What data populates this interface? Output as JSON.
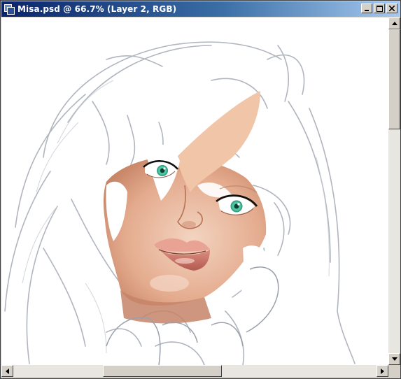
{
  "window": {
    "title": "Misa.psd @ 66.7% (Layer 2, RGB)"
  },
  "title_controls": [
    "minimize-icon",
    "maximize-icon",
    "close-icon"
  ],
  "canvas": {
    "content": "illustration-portrait"
  },
  "scrollbars": {
    "vertical": {
      "position": 0.12
    },
    "horizontal": {
      "position": 0.25
    }
  },
  "colors": {
    "titlebar_start": "#0a246a",
    "titlebar_end": "#a6caf0",
    "chrome": "#d4d0c8",
    "skin": "#e9b79a",
    "eye": "#3fbf9a",
    "lips": "#d98a7a"
  }
}
